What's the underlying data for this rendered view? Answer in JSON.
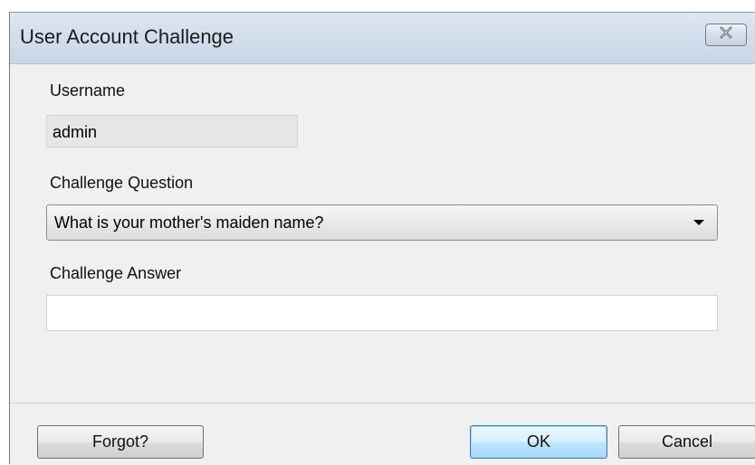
{
  "window": {
    "title": "User Account Challenge"
  },
  "form": {
    "username_label": "Username",
    "username_value": "admin",
    "question_label": "Challenge Question",
    "question_value": "What is your mother's maiden name?",
    "answer_label": "Challenge Answer",
    "answer_value": "",
    "answer_placeholder": ""
  },
  "buttons": {
    "forgot_label": "Forgot?",
    "ok_label": "OK",
    "cancel_label": "Cancel"
  },
  "icons": {
    "close": "close-icon",
    "dropdown": "chevron-down-icon"
  },
  "colors": {
    "title_bar": "#d2deeb",
    "dialog_background": "#f0f0f0",
    "default_button_border": "#3c7fb1"
  }
}
